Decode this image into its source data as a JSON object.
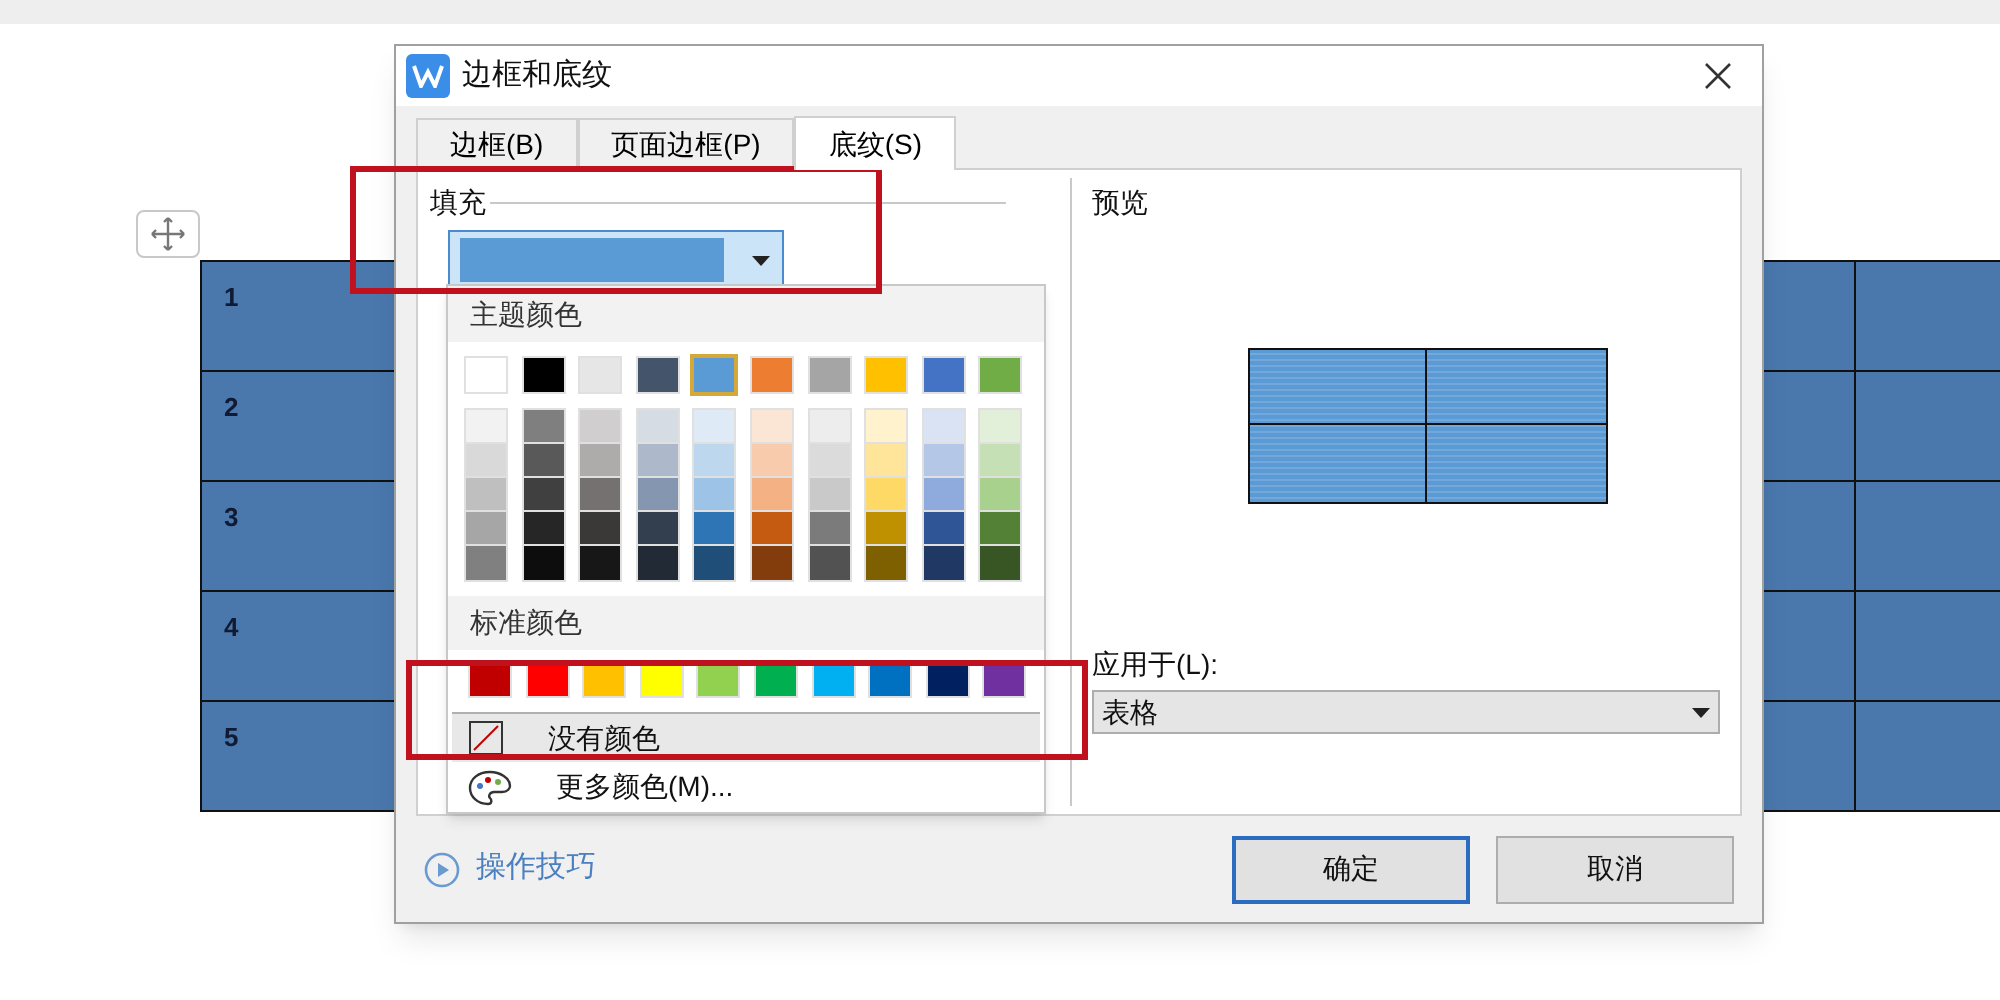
{
  "document": {
    "table_rows": [
      {
        "number": "1"
      },
      {
        "number": "2"
      },
      {
        "number": "3"
      },
      {
        "number": "4"
      },
      {
        "number": "5"
      }
    ]
  },
  "dialog": {
    "title": "边框和底纹",
    "tabs": [
      {
        "label": "边框(B)",
        "selected": false
      },
      {
        "label": "页面边框(P)",
        "selected": false
      },
      {
        "label": "底纹(S)",
        "selected": true
      }
    ],
    "fill": {
      "label": "填充",
      "color": "#5b9bd5",
      "expanded": true
    },
    "color_popup": {
      "theme_title": "主题颜色",
      "theme_colors": [
        {
          "color": "#ffffff",
          "selected": false,
          "shades": [
            {
              "color": "#f2f2f2"
            },
            {
              "color": "#d9d9d9"
            },
            {
              "color": "#bfbfbf"
            },
            {
              "color": "#a6a6a6"
            },
            {
              "color": "#808080"
            }
          ]
        },
        {
          "color": "#000000",
          "selected": false,
          "shades": [
            {
              "color": "#7f7f7f"
            },
            {
              "color": "#595959"
            },
            {
              "color": "#404040"
            },
            {
              "color": "#262626"
            },
            {
              "color": "#0d0d0d"
            }
          ]
        },
        {
          "color": "#e7e6e6",
          "selected": false,
          "shades": [
            {
              "color": "#d0cece"
            },
            {
              "color": "#aeabab"
            },
            {
              "color": "#767171"
            },
            {
              "color": "#3b3838"
            },
            {
              "color": "#181717"
            }
          ]
        },
        {
          "color": "#44546a",
          "selected": false,
          "shades": [
            {
              "color": "#d6dce4"
            },
            {
              "color": "#adb9ca"
            },
            {
              "color": "#8496b0"
            },
            {
              "color": "#333f4f"
            },
            {
              "color": "#222a35"
            }
          ]
        },
        {
          "color": "#5b9bd5",
          "selected": true,
          "shades": [
            {
              "color": "#deebf6"
            },
            {
              "color": "#bdd7ee"
            },
            {
              "color": "#9dc3e6"
            },
            {
              "color": "#2e75b5"
            },
            {
              "color": "#1f4e79"
            }
          ]
        },
        {
          "color": "#ed7d31",
          "selected": false,
          "shades": [
            {
              "color": "#fbe5d5"
            },
            {
              "color": "#f7cbac"
            },
            {
              "color": "#f4b183"
            },
            {
              "color": "#c55a11"
            },
            {
              "color": "#833c0b"
            }
          ]
        },
        {
          "color": "#a5a5a5",
          "selected": false,
          "shades": [
            {
              "color": "#ededed"
            },
            {
              "color": "#dbdbdb"
            },
            {
              "color": "#c9c9c9"
            },
            {
              "color": "#7b7b7b"
            },
            {
              "color": "#525252"
            }
          ]
        },
        {
          "color": "#ffc000",
          "selected": false,
          "shades": [
            {
              "color": "#fff2cc"
            },
            {
              "color": "#fee599"
            },
            {
              "color": "#ffd965"
            },
            {
              "color": "#bf9000"
            },
            {
              "color": "#7f6000"
            }
          ]
        },
        {
          "color": "#4472c4",
          "selected": false,
          "shades": [
            {
              "color": "#dae3f3"
            },
            {
              "color": "#b4c7e7"
            },
            {
              "color": "#8faadc"
            },
            {
              "color": "#2f5597"
            },
            {
              "color": "#203864"
            }
          ]
        },
        {
          "color": "#70ad47",
          "selected": false,
          "shades": [
            {
              "color": "#e2f0d9"
            },
            {
              "color": "#c5e0b4"
            },
            {
              "color": "#a9d18e"
            },
            {
              "color": "#538135"
            },
            {
              "color": "#375623"
            }
          ]
        }
      ],
      "standard_title": "标准颜色",
      "standard_colors": [
        {
          "color": "#c00000"
        },
        {
          "color": "#ff0000"
        },
        {
          "color": "#ffc000"
        },
        {
          "color": "#ffff00"
        },
        {
          "color": "#92d050"
        },
        {
          "color": "#00b050"
        },
        {
          "color": "#00b0f0"
        },
        {
          "color": "#0070c0"
        },
        {
          "color": "#002060"
        },
        {
          "color": "#7030a0"
        }
      ],
      "items": [
        {
          "kind": "none",
          "label": "没有颜色",
          "selected": true
        },
        {
          "kind": "palette",
          "label": "更多颜色(M)...",
          "selected": false
        }
      ]
    },
    "preview": {
      "label": "预览"
    },
    "apply_to": {
      "label": "应用于(L):",
      "value": "表格"
    },
    "tips_link": "操作技巧",
    "buttons": [
      {
        "label": "确定",
        "default": true
      },
      {
        "label": "取消",
        "default": false
      }
    ]
  }
}
